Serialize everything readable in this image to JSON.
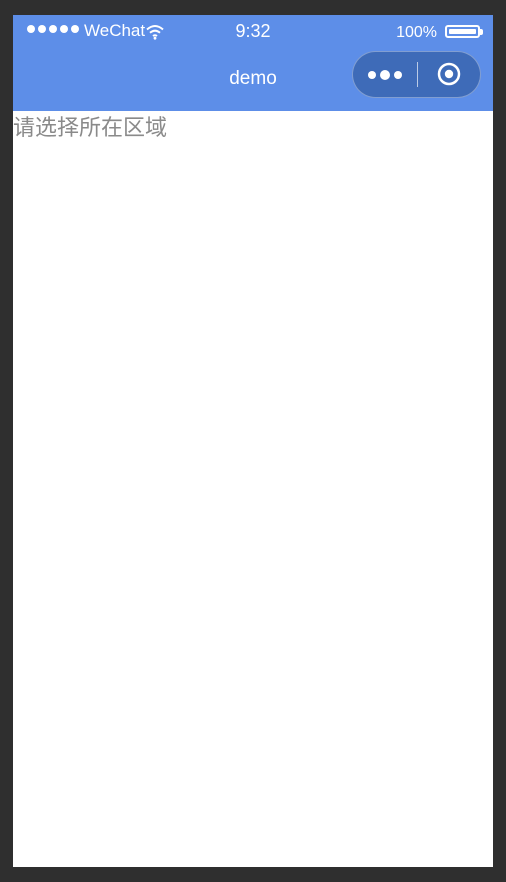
{
  "status_bar": {
    "carrier": "WeChat",
    "time": "9:32",
    "battery_percent": "100%",
    "battery_level": 100,
    "signal_strength": 5,
    "icons": [
      "signal-icon",
      "wifi-icon",
      "battery-icon"
    ]
  },
  "nav_bar": {
    "title": "demo",
    "more_icon": "more-icon",
    "close_icon": "target-icon",
    "color": "#5d8ee8"
  },
  "main": {
    "picker_placeholder": "请选择所在区域",
    "text_color": "#8a8a8a"
  }
}
